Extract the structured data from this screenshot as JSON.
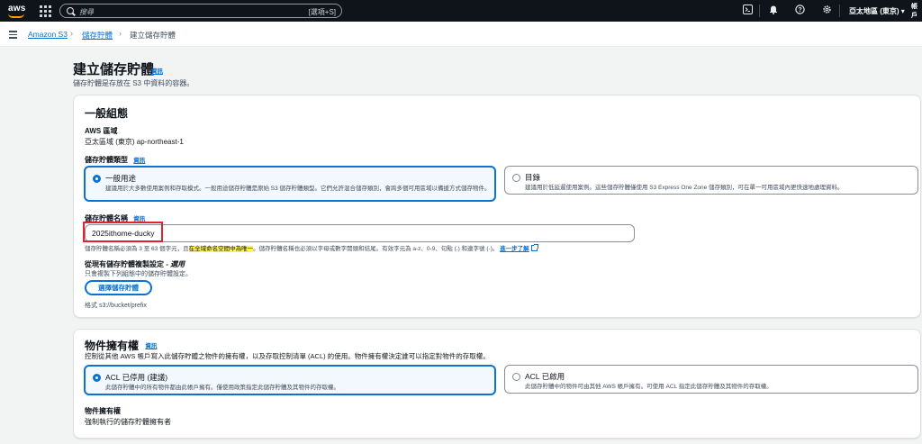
{
  "topnav": {
    "logo": "aws",
    "search_placeholder": "搜尋",
    "search_shortcut": "[選項+S]",
    "icons": [
      "cloudshell-icon",
      "bell-icon",
      "help-icon",
      "gear-icon"
    ],
    "region": "亞太地區 (東京) ▾",
    "user": "帳戶"
  },
  "breadcrumb": {
    "items": [
      "Amazon S3",
      "儲存貯體",
      "建立儲存貯體"
    ]
  },
  "page": {
    "title": "建立儲存貯體",
    "info": "資訊",
    "subtitle": "儲存貯體是存放在 S3 中資料的容器。"
  },
  "general": {
    "title": "一般組態",
    "region_label": "AWS 區域",
    "region_value": "亞太區域 (東京) ap-northeast-1",
    "bucket_type_label": "儲存貯體類型",
    "bucket_type_info": "資訊",
    "types": [
      {
        "label": "一般用途",
        "desc": "建議用於大多數使用案例和存取模式。一般用途儲存貯體是原始 S3 儲存貯體類型。它們允許混合儲存類別，會跨多個可用區域以備援方式儲存物件。",
        "selected": true
      },
      {
        "label": "目錄",
        "desc": "建議用於低延遲使用案例。這些儲存貯體僅使用 S3 Express One Zone 儲存類別，可在單一可用區域內更快速地處理資料。",
        "selected": false
      }
    ],
    "name_label": "儲存貯體名稱",
    "name_info": "資訊",
    "name_value": "2025ithome-ducky",
    "hint_pre": "儲存貯體名稱必須為 3 至 63 個字元，且",
    "hint_highlight": "在全域命名空間中為唯一",
    "hint_post": "。儲存貯體名稱也必須以字母或數字開頭和結尾。有效字元為 a-z、0-9、句點 (.) 和連字號 (-)。",
    "hint_more": "進一步了解",
    "copy_label_main": "從現有儲存貯體複製設定 - ",
    "copy_label_opt": "選用",
    "copy_desc": "只會複製下列組態中的儲存貯體設定。",
    "choose_button": "選擇儲存貯體",
    "format_hint": "格式 s3://bucket/prefix"
  },
  "ownership": {
    "title": "物件擁有權",
    "info": "資訊",
    "desc": "控制從其他 AWS 帳戶寫入此儲存貯體之物件的擁有權，以及存取控制清單 (ACL) 的使用。物件擁有權決定誰可以指定對物件的存取權。",
    "options": [
      {
        "label": "ACL 已停用 (建議)",
        "desc": "此儲存貯體中的所有物件都由此帳戶擁有。僅使用政策指定此儲存貯體及其物件的存取權。",
        "selected": true
      },
      {
        "label": "ACL 已啟用",
        "desc": "此儲存貯體中的物件可由其他 AWS 帳戶擁有。可使用 ACL 指定此儲存貯體及其物件的存取權。",
        "selected": false
      }
    ],
    "owner_label": "物件擁有權",
    "owner_value": "強制執行的儲存貯體擁有者"
  },
  "colors": {
    "accent": "#0972d3",
    "nav_bg": "#0f141a",
    "highlight": "#fff34d",
    "annotation_red": "#e0232e"
  }
}
